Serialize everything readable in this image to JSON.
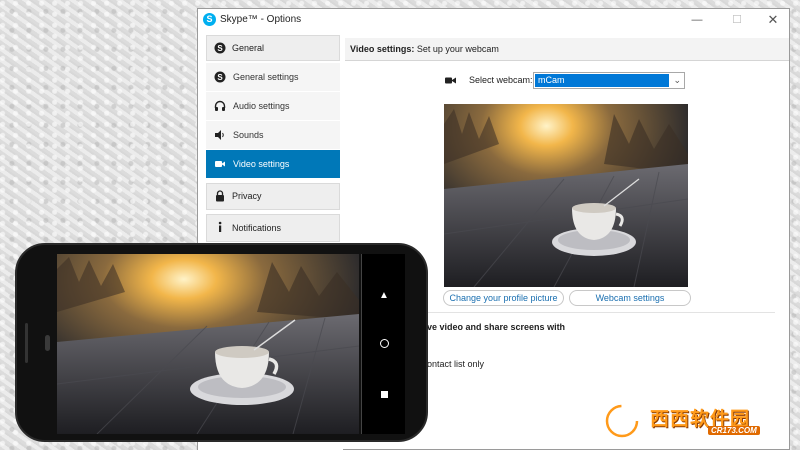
{
  "window": {
    "title": "Skype™ - Options",
    "minimize": "—",
    "maximize": "☐",
    "close": "✕"
  },
  "sidebar": {
    "groups": [
      {
        "label": "General",
        "icon": "skype-icon"
      },
      {
        "label": "Privacy",
        "icon": "lock-icon"
      },
      {
        "label": "Notifications",
        "icon": "info-icon"
      }
    ],
    "items": [
      {
        "label": "General settings",
        "icon": "skype-icon",
        "active": false
      },
      {
        "label": "Audio settings",
        "icon": "headphones-icon",
        "active": false
      },
      {
        "label": "Sounds",
        "icon": "speaker-icon",
        "active": false
      },
      {
        "label": "Video settings",
        "icon": "video-camera-icon",
        "active": true
      }
    ]
  },
  "content": {
    "header_bold": "Video settings:",
    "header_rest": " Set up your webcam",
    "webcam_label": "Select webcam:",
    "webcam_value": "mCam",
    "change_profile_btn": "Change your profile picture",
    "webcam_settings_btn": "Webcam settings",
    "share_text": "ve video and share screens with",
    "contact_text": "ontact list only"
  },
  "phone": {
    "nav_back": "▲"
  },
  "watermark": {
    "text": "西西软件园",
    "sub": "CR173.COM"
  },
  "colors": {
    "accent": "#0078b8",
    "link": "#1a6fb0",
    "select_highlight": "#0078d7",
    "watermark": "#ff9a1a"
  }
}
